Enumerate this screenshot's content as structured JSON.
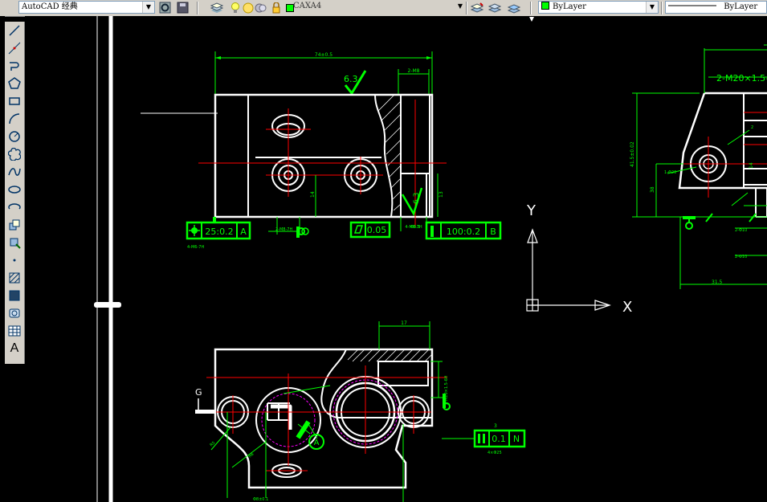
{
  "toolbar": {
    "workspace": "AutoCAD 经典",
    "layer_name": "CAXA4",
    "color": "ByLayer",
    "linetype": "ByLayer"
  },
  "drawing": {
    "top_view": {
      "overall_dim": "74±0.5",
      "roughness": "6.3",
      "thread_dim": "2-M8",
      "ftc_position": {
        "value": "25:0.2",
        "datum": "A",
        "note": "4-M6-7H"
      },
      "ftc_flatness": {
        "value": "0.05"
      },
      "ftc_perp": {
        "value": "100:0.2",
        "datum": "B",
        "note": "Φ8.5"
      },
      "small_label_a": "4-M6-7H",
      "small_label_b": "2-M8-7H",
      "dim_14": "14",
      "dim_13": "13",
      "side_roughness": "6.3"
    },
    "ucs": {
      "y_label": "Y",
      "x_label": "X"
    },
    "right_view": {
      "thread_callout": "2-M20×1.5-6",
      "dim_a": "41.5±0.02",
      "dim_b": "38",
      "dim_c": "14",
      "dim_d": "31.5",
      "dim_e": "1-Φ20",
      "dim_f": "2-Φ10",
      "dim_g": "2-Φ10"
    },
    "bottom_view": {
      "dim_17": "17",
      "vert_dim": "2-M20×1.5-6H",
      "section_label": "G",
      "datum_label": "A",
      "ftc_parallel": {
        "value": "0.1",
        "datum": "N",
        "ref": "3",
        "note": "4×Φ25"
      },
      "angle_dim": "R5",
      "r_dim": "R8",
      "bottom_note": "Φ8±0.1"
    }
  },
  "colors": {
    "background": "#000000",
    "geometry": "#ffffff",
    "dimension": "#00ff00",
    "centerline": "#ff0000",
    "hidden": "#ff00ff"
  },
  "icons": {
    "left_toolbar": [
      "line-icon",
      "construction-line-icon",
      "polyline-icon",
      "polygon-icon",
      "rectangle-icon",
      "arc-icon",
      "circle-icon",
      "revision-cloud-icon",
      "spline-icon",
      "ellipse-icon",
      "ellipse-arc-icon",
      "insert-block-icon",
      "make-block-icon",
      "point-icon",
      "hatch-icon",
      "gradient-icon",
      "region-icon",
      "table-icon",
      "multiline-text-icon"
    ],
    "multiline_text_glyph": "A"
  }
}
